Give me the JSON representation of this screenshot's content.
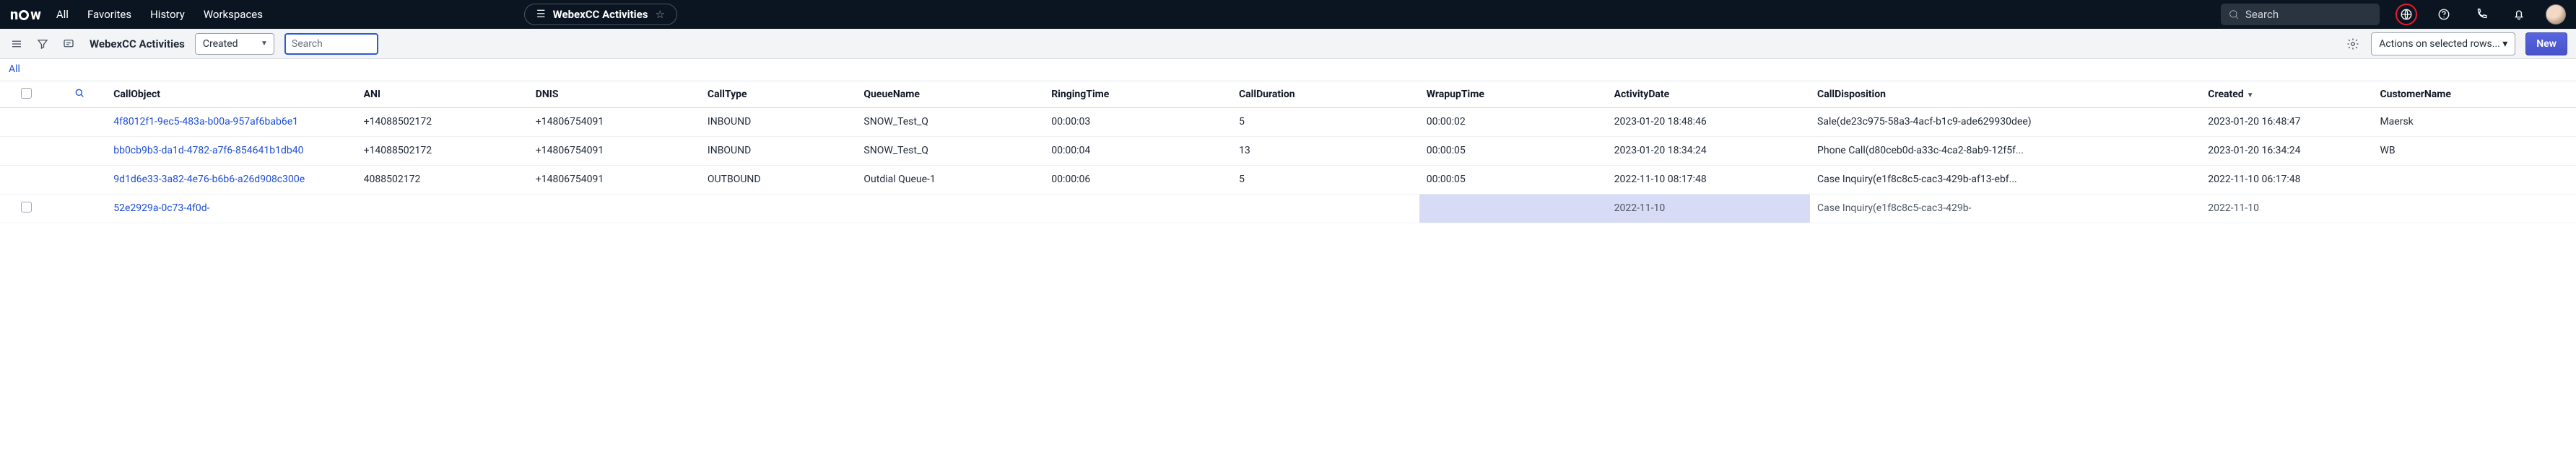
{
  "topbar": {
    "logo": "now",
    "nav": [
      "All",
      "Favorites",
      "History",
      "Workspaces"
    ],
    "pill_title": "WebexCC Activities",
    "search_placeholder": "Search"
  },
  "toolbar": {
    "title": "WebexCC Activities",
    "select_value": "Created",
    "search_placeholder": "Search",
    "actions_placeholder": "Actions on selected rows...",
    "new_label": "New"
  },
  "all_link": "All",
  "columns": {
    "call": "CallObject",
    "ani": "ANI",
    "dnis": "DNIS",
    "type": "CallType",
    "queue": "QueueName",
    "ring": "RingingTime",
    "dur": "CallDuration",
    "wrap": "WrapupTime",
    "act": "ActivityDate",
    "disp": "CallDisposition",
    "created": "Created",
    "cust": "CustomerName"
  },
  "rows": [
    {
      "call": "4f8012f1-9ec5-483a-b00a-957af6bab6e1",
      "ani": "+14088502172",
      "dnis": "+14806754091",
      "type": "INBOUND",
      "queue": "SNOW_Test_Q",
      "ring": "00:00:03",
      "dur": "5",
      "wrap": "00:00:02",
      "act": "2023-01-20 18:48:46",
      "disp": "Sale(de23c975-58a3-4acf-b1c9-ade629930dee)",
      "created": "2023-01-20 16:48:47",
      "cust": "Maersk"
    },
    {
      "call": "bb0cb9b3-da1d-4782-a7f6-854641b1db40",
      "ani": "+14088502172",
      "dnis": "+14806754091",
      "type": "INBOUND",
      "queue": "SNOW_Test_Q",
      "ring": "00:00:04",
      "dur": "13",
      "wrap": "00:00:05",
      "act": "2023-01-20 18:34:24",
      "disp": "Phone Call(d80ceb0d-a33c-4ca2-8ab9-12f5f...",
      "created": "2023-01-20 16:34:24",
      "cust": "WB"
    },
    {
      "call": "9d1d6e33-3a82-4e76-b6b6-a26d908c300e",
      "ani": "4088502172",
      "dnis": "+14806754091",
      "type": "OUTBOUND",
      "queue": "Outdial Queue-1",
      "ring": "00:00:06",
      "dur": "5",
      "wrap": "00:00:05",
      "act": "2022-11-10 08:17:48",
      "disp": "Case Inquiry(e1f8c8c5-cac3-429b-af13-ebf...",
      "created": "2022-11-10 06:17:48",
      "cust": ""
    },
    {
      "call": "52e2929a-0c73-4f0d-",
      "ani": "",
      "dnis": "",
      "type": "",
      "queue": "",
      "ring": "",
      "dur": "",
      "wrap": "",
      "act": "2022-11-10",
      "disp": "Case Inquiry(e1f8c8c5-cac3-429b-",
      "created": "2022-11-10",
      "cust": ""
    }
  ]
}
